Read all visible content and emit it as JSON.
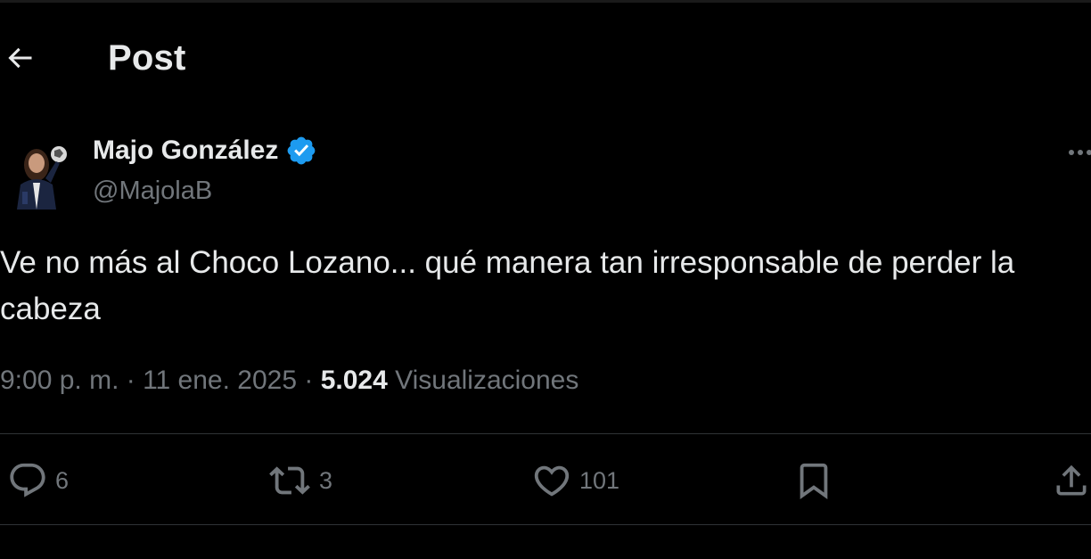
{
  "header": {
    "title": "Post",
    "back_icon": "arrow-left-icon"
  },
  "author": {
    "name": "Majo González",
    "handle": "@MajolaB",
    "verified": true,
    "verified_color": "#1d9bf0"
  },
  "post": {
    "text_line1": "Ve no más al Choco Lozano... qué manera tan irresponsable de perder la",
    "text_line2": "cabeza",
    "time": "9:00 p. m.",
    "date": "11 ene. 2025",
    "separator": "·",
    "views_count": "5.024",
    "views_label": "Visualizaciones"
  },
  "actions": {
    "reply": {
      "icon": "reply-icon",
      "count": "6"
    },
    "repost": {
      "icon": "repost-icon",
      "count": "3"
    },
    "like": {
      "icon": "heart-icon",
      "count": "101"
    },
    "bookmark": {
      "icon": "bookmark-icon"
    },
    "share": {
      "icon": "share-icon"
    }
  },
  "colors": {
    "background": "#000000",
    "text": "#e7e9ea",
    "secondary": "#71767b",
    "divider": "#2f3336",
    "accent": "#1d9bf0"
  }
}
